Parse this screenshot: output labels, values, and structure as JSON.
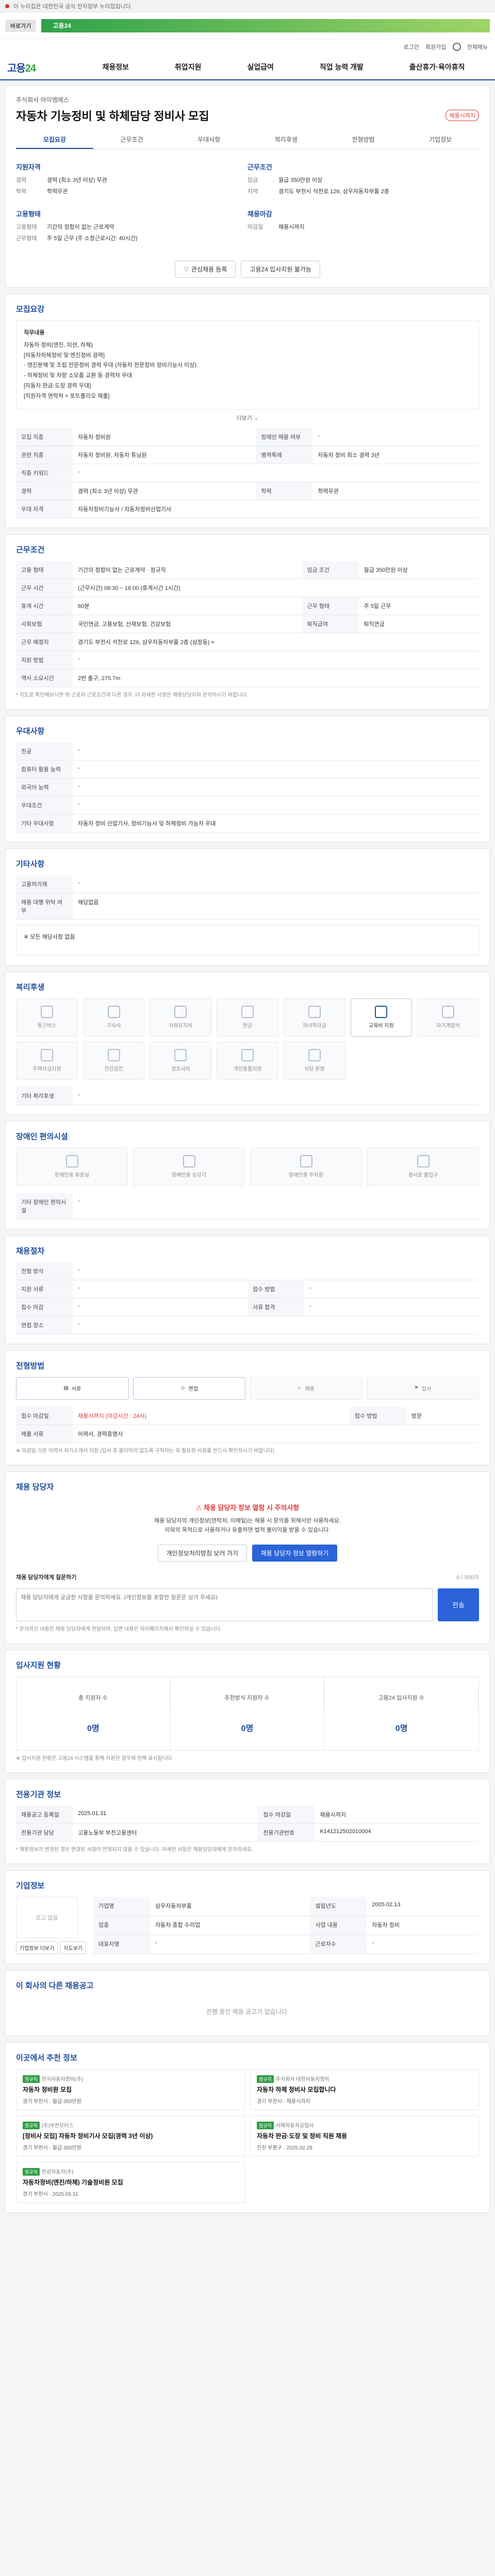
{
  "topbar": {
    "notice": "이 누리집은 대한민국 공식 전자정부 누리집입니다."
  },
  "gov": {
    "go_label": "바로가기",
    "banner": "고용24"
  },
  "gnb_top": {
    "links": [
      "로그인",
      "회원가입",
      "전체메뉴"
    ]
  },
  "gnb": {
    "logo_main": "고용",
    "logo_num": "24",
    "menu": [
      "채용정보",
      "취업지원",
      "실업급여",
      "직업 능력 개발",
      "출산휴가·육아휴직"
    ]
  },
  "header": {
    "company": "주식회사 아이엠에스",
    "title": "자동차 기능정비 및 하체담당 정비사 모집",
    "badge": "채용시까지"
  },
  "tabs": [
    "모집요강",
    "근무조건",
    "우대사항",
    "복리후생",
    "전형방법",
    "기업정보"
  ],
  "summary": {
    "qualify_title": "지원자격",
    "work_title": "근무조건",
    "qualify": [
      {
        "k": "경력",
        "v": "경력 (최소 3년 이상) 무관"
      },
      {
        "k": "학력",
        "v": "학력무관"
      }
    ],
    "work": [
      {
        "k": "임금",
        "v": "월급 350만원 이상"
      },
      {
        "k": "지역",
        "v": "경기도 부천시 석천로 126, 삼우자동차부품 2층"
      }
    ],
    "type_title": "고용형태",
    "type": [
      {
        "k": "고용형태",
        "v": "기간의 정함이 없는 근로계약"
      },
      {
        "k": "근무형태",
        "v": "주 5일 근무 (주 소정근로시간: 40시간)"
      }
    ],
    "deadline_title": "채용마감",
    "deadline": [
      {
        "k": "마감일",
        "v": "채용시까지"
      }
    ]
  },
  "buttons": {
    "interest": "관심채용 등록",
    "apply": "고용24 입사지원 불가능"
  },
  "recruit": {
    "section": "모집요강",
    "duty_label": "직무내용",
    "duty_lines": [
      "자동차 정비(엔진, 미션, 하체)",
      "[자동차하체정비 및 엔진정비 경력]",
      "- 엔진분해 및 조립 전문정비 경력 우대 (자동차 전문정비 정비기능사 이상)",
      "- 하체정비 및 차량 소모품 교환 등 경력자 우대",
      "[자동차 판금·도장 경력 우대]",
      "[지원자격 연락처 + 포트폴리오 제출]"
    ],
    "more": "더보기",
    "rows": [
      {
        "k": "모집 직종",
        "v": "자동차 정비원"
      },
      {
        "k": "관련 직종",
        "v": "자동차 정비원, 자동차 튜닝원"
      },
      {
        "k": "직종 키워드",
        "v": "-"
      },
      {
        "k": "경력",
        "v": "경력 (최소 3년 이상) 무관"
      },
      {
        "k": "학력",
        "v": "학력무관"
      },
      {
        "k": "모집 인원",
        "v": "1명"
      },
      {
        "k": "우대 자격",
        "v": "자동차정비기능사 / 자동차정비산업기사"
      }
    ],
    "right_rows": [
      {
        "k": "장애인 채용 여부",
        "v": "-"
      },
      {
        "k": "병역특례",
        "v": "자동차 정비 최소 경력 3년"
      },
      {
        "k": "모집 인원",
        "v": "1명"
      }
    ]
  },
  "work": {
    "section": "근무조건",
    "rows": [
      {
        "k": "고용 형태",
        "v": "기간의 정함이 없는 근로계약 · 정규직"
      },
      {
        "k": "임금 조건",
        "v": "월급 350만원 이상"
      },
      {
        "k": "근무 시간",
        "v": "(근무시간) 08:30 ~ 18:00 (휴게시간 1시간)"
      },
      {
        "k": "휴게 시간",
        "v": "60분"
      },
      {
        "k": "근무 형태",
        "v": "주 5일 근무"
      },
      {
        "k": "사회보험",
        "v": "국민연금, 고용보험, 산재보험, 건강보험"
      },
      {
        "k": "퇴직급여",
        "v": "퇴직연금"
      },
      {
        "k": "근무 예정지",
        "v": "경기도 부천시 석천로 126, 삼우자동차부품 2층 (삼정동)"
      },
      {
        "k": "지원 방법",
        "v": "-"
      },
      {
        "k": "역사 소요시간",
        "v": "2번 출구, 275.7m"
      }
    ],
    "note": "* 지도로 확인해보시면 위 근로자 근로조건과 다른 경우, 더 자세한 사항은 채용담당자와 문의하시기 바랍니다."
  },
  "prefer": {
    "section": "우대사항",
    "rows": [
      {
        "k": "전공",
        "v": "-"
      },
      {
        "k": "컴퓨터 활용 능력",
        "v": "-"
      },
      {
        "k": "외국어 능력",
        "v": "-"
      },
      {
        "k": "우대조건",
        "v": "-"
      },
      {
        "k": "기타 우대사항",
        "v": "자동차 정비 산업기사, 정비기능사 및 하체정비 가능자 우대"
      }
    ]
  },
  "other": {
    "section": "기타사항",
    "rows": [
      {
        "k": "고용허가제",
        "v": "-"
      },
      {
        "k": "채용 대행 위탁 여부",
        "v": "해당없음"
      }
    ],
    "extra": "※ 모든 해당사항 없음"
  },
  "welfare": {
    "section": "복리후생",
    "items": [
      "통근버스",
      "기숙사",
      "차량유지비",
      "연금",
      "자녀학자금",
      "교육비 지원",
      "자기계발비",
      "주택자금지원",
      "건강검진",
      "경조사비",
      "개인용품지원",
      "식당 운영"
    ],
    "on_index": [
      5
    ],
    "etc_label": "기타 복리후생",
    "etc_value": "-"
  },
  "disabled": {
    "section": "장애인 편의시설",
    "items": [
      "장애인용 화장실",
      "장애인용 승강기",
      "장애인용 주차장",
      "경사로 출입구"
    ],
    "etc_label": "기타 장애인 편의시설",
    "etc_value": "-"
  },
  "process": {
    "section": "채용절차",
    "rows": [
      {
        "k": "전형 방식",
        "v": "-"
      },
      {
        "k": "지원 서류",
        "v": "-"
      },
      {
        "k": "접수 방법",
        "v": "-"
      },
      {
        "k": "접수 마감",
        "v": "-"
      },
      {
        "k": "서류 합격",
        "v": "-"
      },
      {
        "k": "면접 장소",
        "v": "-"
      }
    ]
  },
  "method": {
    "section": "전형방법",
    "steps": [
      "서류",
      "면접",
      "채용",
      "입사"
    ],
    "receive_title": "접수 마감일",
    "receive_value": "채용시까지 (마감시간 : 24시)",
    "docs_title": "접수 방법",
    "docs_value": "방문",
    "app_title": "제출 서류",
    "app_value": "이력서, 경력증명서",
    "note": "※ 마감일 기준 이력서 자기소개서 지참 (입사 후 불이익이 없도록 구직자는 꼭 필요한 서류를 반드시 확인하시기 바랍니다)"
  },
  "contact": {
    "section": "채용 담당자",
    "alert": "채용 담당자 정보 열람 시 주의사항",
    "lines": [
      "채용 담당자의 개인정보(연락처, 이메일)는 채용 시 문의를 위해서만 사용하세요.",
      "이외의 목적으로 사용하거나 유출하면 법적 불이익을 받을 수 있습니다."
    ],
    "agree_label": "개인정보처리방침 보러 가기",
    "view_label": "채용 담당자 정보 열람하기",
    "q_label": "채용 담당자에게 질문하기",
    "q_placeholder": "채용 담당자에게 궁금한 사항을 문의하세요. (개인정보를 포함한 질문은 삼가 주세요)",
    "q_count": "0 / 500자",
    "send": "전송",
    "q_note": "* 문의하신 내용은 채용 담당자에게 전달되며, 답변 내용은 마이페이지에서 확인하실 수 있습니다."
  },
  "stats": {
    "section": "입사지원 현황",
    "items": [
      {
        "label": "총 지원자 수",
        "value": "0명"
      },
      {
        "label": "추천방식 지원자 수",
        "value": "0명"
      },
      {
        "label": "고용24 입사지원 수",
        "value": "0명"
      }
    ],
    "note": "※ 입사지원 현황은 고용24 시스템을 통해 지원한 경우에 한해 표시됩니다."
  },
  "agency": {
    "section": "전용기관 정보",
    "rows": [
      {
        "k": "채용공고 등록일",
        "v": "2025.01.31"
      },
      {
        "k": "접수 마감일",
        "v": "채용시까지"
      },
      {
        "k": "전용기관 담당",
        "v": "고용노동부 부천고용센터"
      },
      {
        "k": "전용기관번호",
        "v": "K141212502010004"
      }
    ],
    "note": "* 채용정보가 변경된 경우 변경된 사항이 반영되지 않을 수 있습니다. 자세한 사항은 채용담당자에게 문의하세요."
  },
  "company": {
    "section": "기업정보",
    "logo_text": "로고 없음",
    "rows": [
      {
        "k": "기업명",
        "v": "삼우자동차부품"
      },
      {
        "k": "업종",
        "v": "자동차 종합 수리업"
      },
      {
        "k": "대표자명",
        "v": "-"
      },
      {
        "k": "설립년도",
        "v": "2005.02.13"
      },
      {
        "k": "사업 내용",
        "v": "자동차 정비"
      },
      {
        "k": "근로자수",
        "v": "-"
      }
    ],
    "btn_info": "기업정보 더보기",
    "btn_map": "지도보기"
  },
  "jobs_same": {
    "section": "이 회사의 다른 채용공고",
    "empty": "진행 중인 채용 공고가 없습니다."
  },
  "recommend": {
    "section": "이곳에서 추천 정보",
    "items": [
      {
        "tag": "정규직",
        "co": "한국자동차정비(주)",
        "title": "자동차 정비원 모집",
        "meta": "경기 부천시 · 월급 350만원"
      },
      {
        "tag": "정규직",
        "co": "주식회사 대한자동차정비",
        "title": "자동차 하체 정비사 모집합니다",
        "meta": "경기 부천시 · 채용시까지"
      },
      {
        "tag": "정규직",
        "co": "(주)부천모터스",
        "title": "[정비사 모집] 자동차 정비기사 모집(경력 3년 이상)",
        "meta": "경기 부천시 · 월급 360만원"
      },
      {
        "tag": "정규직",
        "co": "서해자동차공업사",
        "title": "자동차 판금·도장 및 정비 직원 채용",
        "meta": "인천 부평구 · 2025.02.28"
      },
      {
        "tag": "정규직",
        "co": "한성자동차(주)",
        "title": "자동차정비(엔진/하체) 기술정비원 모집",
        "meta": "경기 부천시 · 2025.03.31"
      }
    ]
  }
}
